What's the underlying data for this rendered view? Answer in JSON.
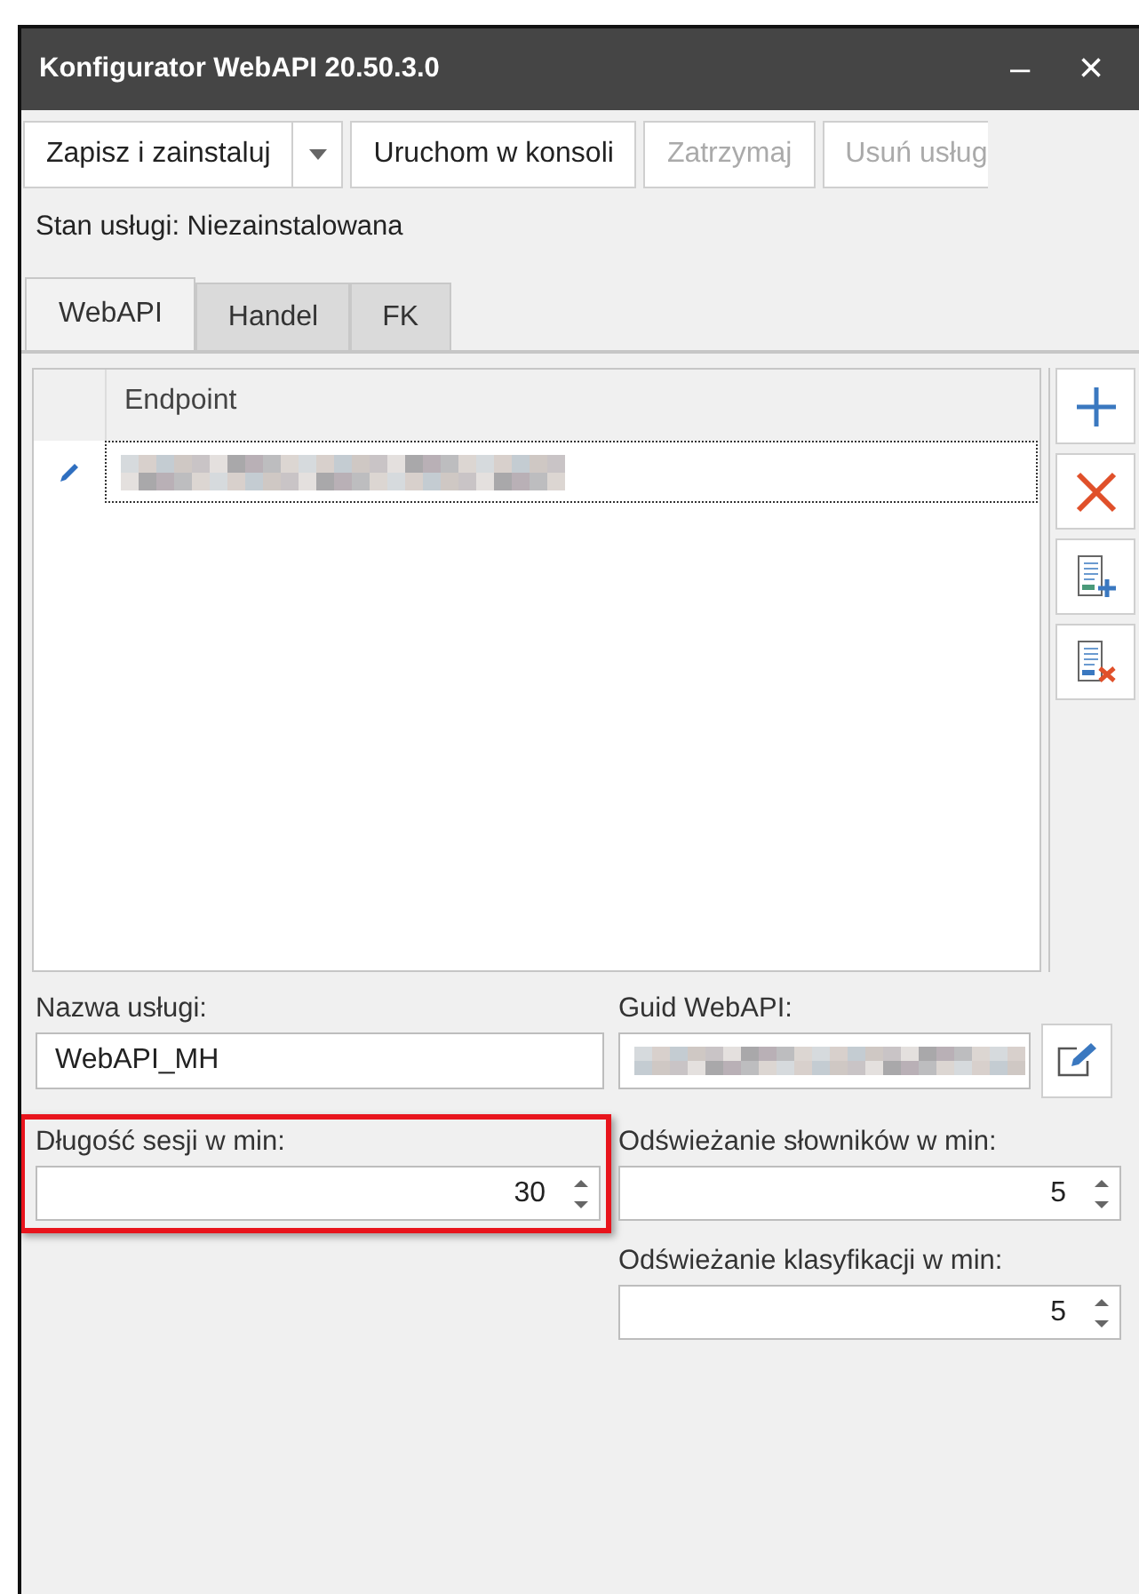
{
  "window": {
    "title": "Konfigurator WebAPI 20.50.3.0",
    "controls": [
      "–",
      "×"
    ]
  },
  "toolbar": [
    {
      "label": "Zapisz i zainstaluj",
      "kind": "split",
      "disabled": false
    },
    {
      "label": "Uruchom w konsoli",
      "kind": "plain",
      "disabled": false
    },
    {
      "label": "Zatrzymaj",
      "kind": "plain",
      "disabled": true
    },
    {
      "label": "Usuń usług",
      "kind": "plain",
      "disabled": true
    }
  ],
  "status": "Stan usługi: Niezainstalowana",
  "tabs": [
    {
      "label": "WebAPI",
      "selected": true
    },
    {
      "label": "Handel",
      "selected": false
    },
    {
      "label": "FK",
      "selected": false
    }
  ],
  "grid": {
    "columns": [
      "Endpoint"
    ],
    "rows": [
      {
        "editing": true,
        "redacted": true,
        "focused": true
      }
    ]
  },
  "grid_actions": [
    {
      "kind": "add"
    },
    {
      "kind": "delete"
    },
    {
      "kind": "doc-add"
    },
    {
      "kind": "doc-delete"
    }
  ],
  "fields": {
    "service_name": {
      "label": "Nazwa usługi:",
      "value": "WebAPI_MH"
    },
    "guid": {
      "label": "Guid WebAPI:",
      "redacted": true
    },
    "session": {
      "label": "Długość sesji w min:",
      "value": "30",
      "highlighted": true
    },
    "dict_refresh": {
      "label": "Odświeżanie słowników w min:",
      "value": "5"
    },
    "class_refresh": {
      "label": "Odświeżanie klasyfikacji w min:",
      "value": "5"
    }
  }
}
